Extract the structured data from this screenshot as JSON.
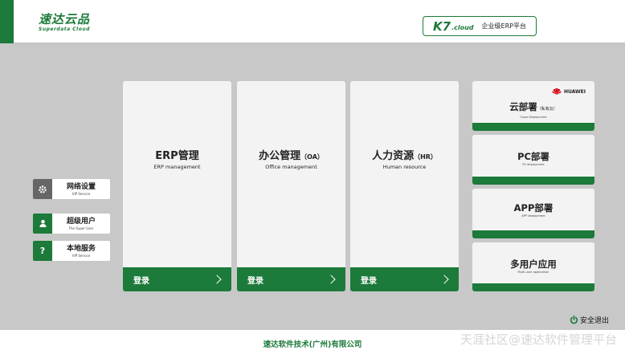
{
  "header": {
    "logo_cn": "速达云品",
    "logo_en": "Superdata Cloud",
    "k7_brand": "K7",
    "k7_cloud": ".cloud",
    "k7_subtitle": "企业级ERP平台"
  },
  "left_buttons": [
    {
      "label": "网络设置",
      "sub": "VIP Service",
      "icon": "gear-icon",
      "icon_color": "#666666"
    },
    {
      "label": "超级用户",
      "sub": "The Super User",
      "icon": "user-icon",
      "icon_color": "#1c7a3a"
    },
    {
      "label": "本地服务",
      "sub": "VIP Service",
      "icon": "question-icon",
      "icon_color": "#1c7a3a"
    }
  ],
  "modules": [
    {
      "title": "ERP管理",
      "title_suffix": "",
      "sub": "ERP management",
      "login": "登录"
    },
    {
      "title": "办公管理",
      "title_suffix": "（OA）",
      "sub": "Office management",
      "login": "登录"
    },
    {
      "title": "人力资源",
      "title_suffix": "（HR）",
      "sub": "Human resource",
      "login": "登录"
    }
  ],
  "deploy": [
    {
      "title": "云部署",
      "title_suffix": "（私有云）",
      "sub": "Cloud Deployment",
      "badge": "HUAWEI"
    },
    {
      "title": "PC部署",
      "title_suffix": "",
      "sub": "PC deployment"
    },
    {
      "title": "APP部署",
      "title_suffix": "",
      "sub": "APP deployment"
    },
    {
      "title": "多用户应用",
      "title_suffix": "",
      "sub": "Multi-user application"
    }
  ],
  "logout_label": "安全退出",
  "footer": {
    "company": "速达软件技术(广州)有限公司",
    "watermark": "天涯社区@速达软件管理平台"
  },
  "colors": {
    "brand": "#1c7a3a",
    "background": "#c8c8c8",
    "card": "#f3f3f3"
  }
}
